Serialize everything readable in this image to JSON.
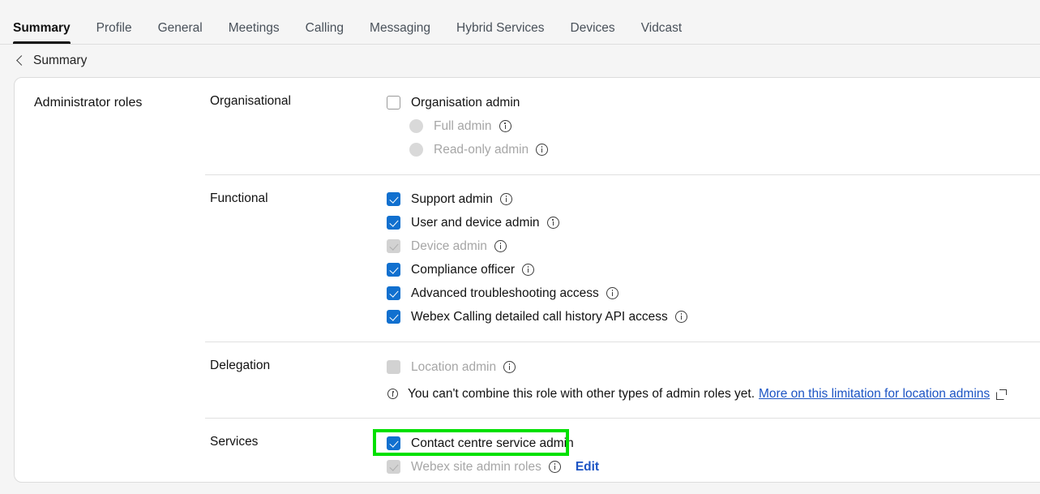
{
  "tabs": [
    {
      "label": "Summary",
      "active": true
    },
    {
      "label": "Profile",
      "active": false
    },
    {
      "label": "General",
      "active": false
    },
    {
      "label": "Meetings",
      "active": false
    },
    {
      "label": "Calling",
      "active": false
    },
    {
      "label": "Messaging",
      "active": false
    },
    {
      "label": "Hybrid Services",
      "active": false
    },
    {
      "label": "Devices",
      "active": false
    },
    {
      "label": "Vidcast",
      "active": false
    }
  ],
  "breadcrumb": {
    "back_icon": "chevron-left-icon",
    "label": "Summary"
  },
  "card": {
    "title": "Administrator roles",
    "groups": [
      {
        "key": "organisational",
        "label": "Organisational",
        "options": [
          {
            "type": "checkbox",
            "label": "Organisation admin",
            "checked": false,
            "disabled": false,
            "indent": false,
            "info": false
          },
          {
            "type": "radio",
            "label": "Full admin",
            "checked": false,
            "disabled": true,
            "indent": true,
            "info": true
          },
          {
            "type": "radio",
            "label": "Read-only admin",
            "checked": false,
            "disabled": true,
            "indent": true,
            "info": true
          }
        ]
      },
      {
        "key": "functional",
        "label": "Functional",
        "options": [
          {
            "type": "checkbox",
            "label": "Support admin",
            "checked": true,
            "disabled": false,
            "indent": false,
            "info": true
          },
          {
            "type": "checkbox",
            "label": "User and device admin",
            "checked": true,
            "disabled": false,
            "indent": false,
            "info": true
          },
          {
            "type": "checkbox",
            "label": "Device admin",
            "checked": true,
            "disabled": true,
            "indent": false,
            "info": true
          },
          {
            "type": "checkbox",
            "label": "Compliance officer",
            "checked": true,
            "disabled": false,
            "indent": false,
            "info": true
          },
          {
            "type": "checkbox",
            "label": "Advanced troubleshooting access",
            "checked": true,
            "disabled": false,
            "indent": false,
            "info": true
          },
          {
            "type": "checkbox",
            "label": "Webex Calling detailed call history API access",
            "checked": true,
            "disabled": false,
            "indent": false,
            "info": true
          }
        ]
      },
      {
        "key": "delegation",
        "label": "Delegation",
        "options": [
          {
            "type": "checkbox",
            "label": "Location admin",
            "checked": false,
            "disabled": true,
            "indent": false,
            "info": true
          }
        ],
        "note": {
          "icon": "info-icon",
          "text": "You can't combine this role with other types of admin roles yet.",
          "link_text": "More on this limitation for location admins",
          "link_icon": "external-link-icon"
        }
      },
      {
        "key": "services",
        "label": "Services",
        "options": [
          {
            "type": "checkbox",
            "label": "Contact centre service admin",
            "checked": true,
            "disabled": false,
            "indent": false,
            "info": false,
            "highlighted": true
          },
          {
            "type": "checkbox",
            "label": "Webex site admin roles",
            "checked": true,
            "disabled": true,
            "indent": false,
            "info": true,
            "action_label": "Edit"
          }
        ]
      }
    ]
  },
  "colors": {
    "accent_blue": "#1170CF",
    "link_blue": "#1C54C4",
    "highlight_green": "#00E000",
    "page_background": "#F5F5F5",
    "card_background": "#FFFFFF",
    "disabled_grey": "#D2D2D2"
  }
}
